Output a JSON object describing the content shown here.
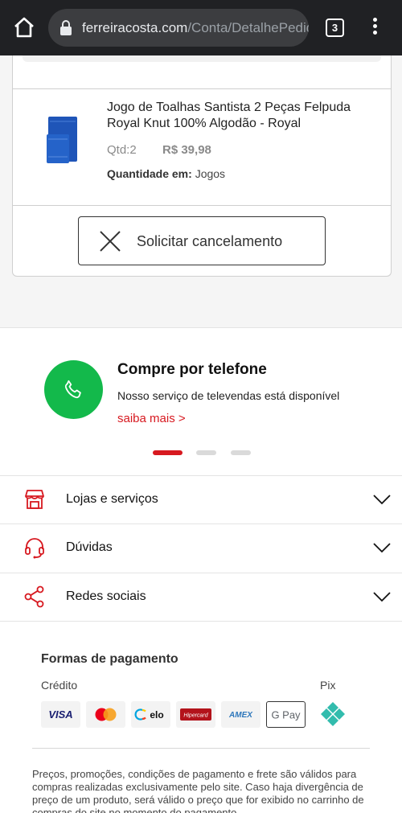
{
  "browser": {
    "url_domain": "ferreiracosta.com",
    "url_path": "/Conta/DetalhePedid",
    "tab_count": "3"
  },
  "order": {
    "product_name": "Jogo de Toalhas Santista 2 Peças Felpuda Royal Knut 100% Algodão - Royal",
    "quantity": "Qtd:2",
    "price": "R$ 39,98",
    "unit_label": "Quantidade em:",
    "unit_value": "Jogos",
    "cancel_label": "Solicitar cancelamento"
  },
  "phone_banner": {
    "title": "Compre por telefone",
    "description": "Nosso serviço de televendas está disponível",
    "link": "saiba mais >",
    "carousel_active_index": 0,
    "carousel_count": 3
  },
  "accordion": [
    {
      "label": "Lojas e serviços",
      "icon": "store-icon"
    },
    {
      "label": "Dúvidas",
      "icon": "headset-icon"
    },
    {
      "label": "Redes sociais",
      "icon": "share-icon"
    }
  ],
  "payment": {
    "title": "Formas de pagamento",
    "credit_label": "Crédito",
    "pix_label": "Pix",
    "methods": [
      "VISA",
      "Mastercard",
      "elo",
      "Hipercard",
      "AMEX",
      "G Pay"
    ]
  },
  "legal_text": "Preços, promoções, condições de pagamento e frete são válidos para compras realizadas exclusivamente pelo site. Caso haja divergência de preço de um produto, será válido o preço que for exibido no carrinho de compras do site no momento do pagamento.",
  "colors": {
    "accent_red": "#d71920",
    "whatsapp_green": "#13b94b",
    "chrome_dark": "#202124"
  }
}
